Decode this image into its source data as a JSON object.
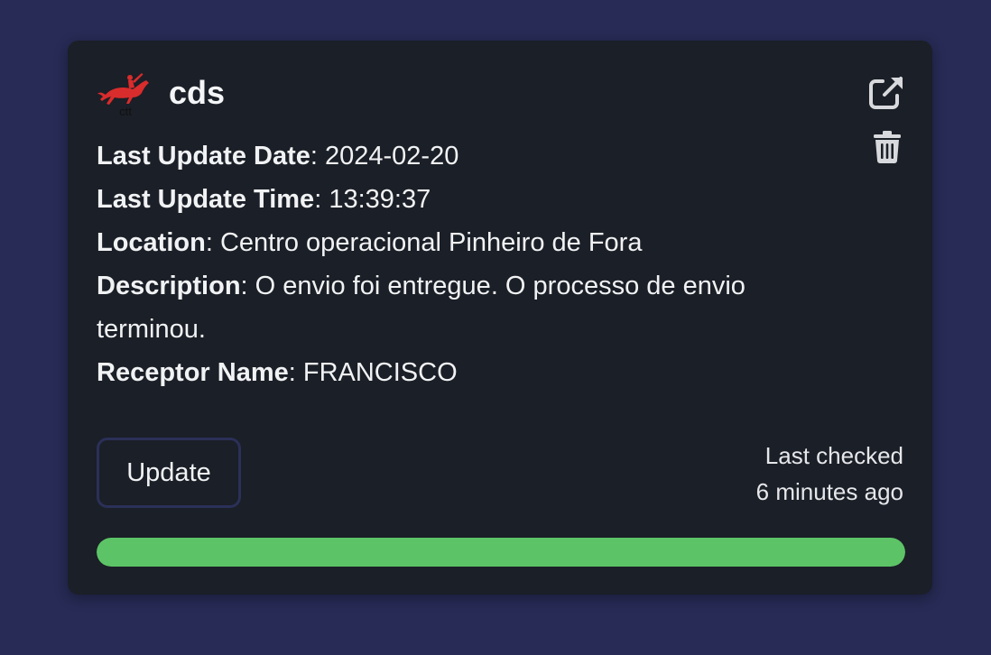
{
  "card": {
    "title": "cds",
    "logo": {
      "icon": "ctt-horse-rider-logo",
      "text": "ctt",
      "color": "#d92c2c"
    },
    "actions": {
      "open_icon": "external-link-icon",
      "delete_icon": "trash-icon"
    },
    "details": {
      "last_update_date": {
        "label": "Last Update Date",
        "value": ": 2024-02-20"
      },
      "last_update_time": {
        "label": "Last Update Time",
        "value": ": 13:39:37"
      },
      "location": {
        "label": "Location",
        "value": ": Centro operacional Pinheiro de Fora"
      },
      "description": {
        "label": "Description",
        "value": ": O envio foi entregue. O processo de envio terminou."
      },
      "receptor_name": {
        "label": "Receptor Name",
        "value": ": FRANCISCO"
      }
    },
    "update_button_label": "Update",
    "last_checked_line1": "Last checked",
    "last_checked_line2": "6 minutes ago",
    "progress_percent": 100,
    "colors": {
      "background": "#272b55",
      "card": "#1b1f27",
      "progress": "#5cc466",
      "button_border": "#2b3058"
    }
  }
}
